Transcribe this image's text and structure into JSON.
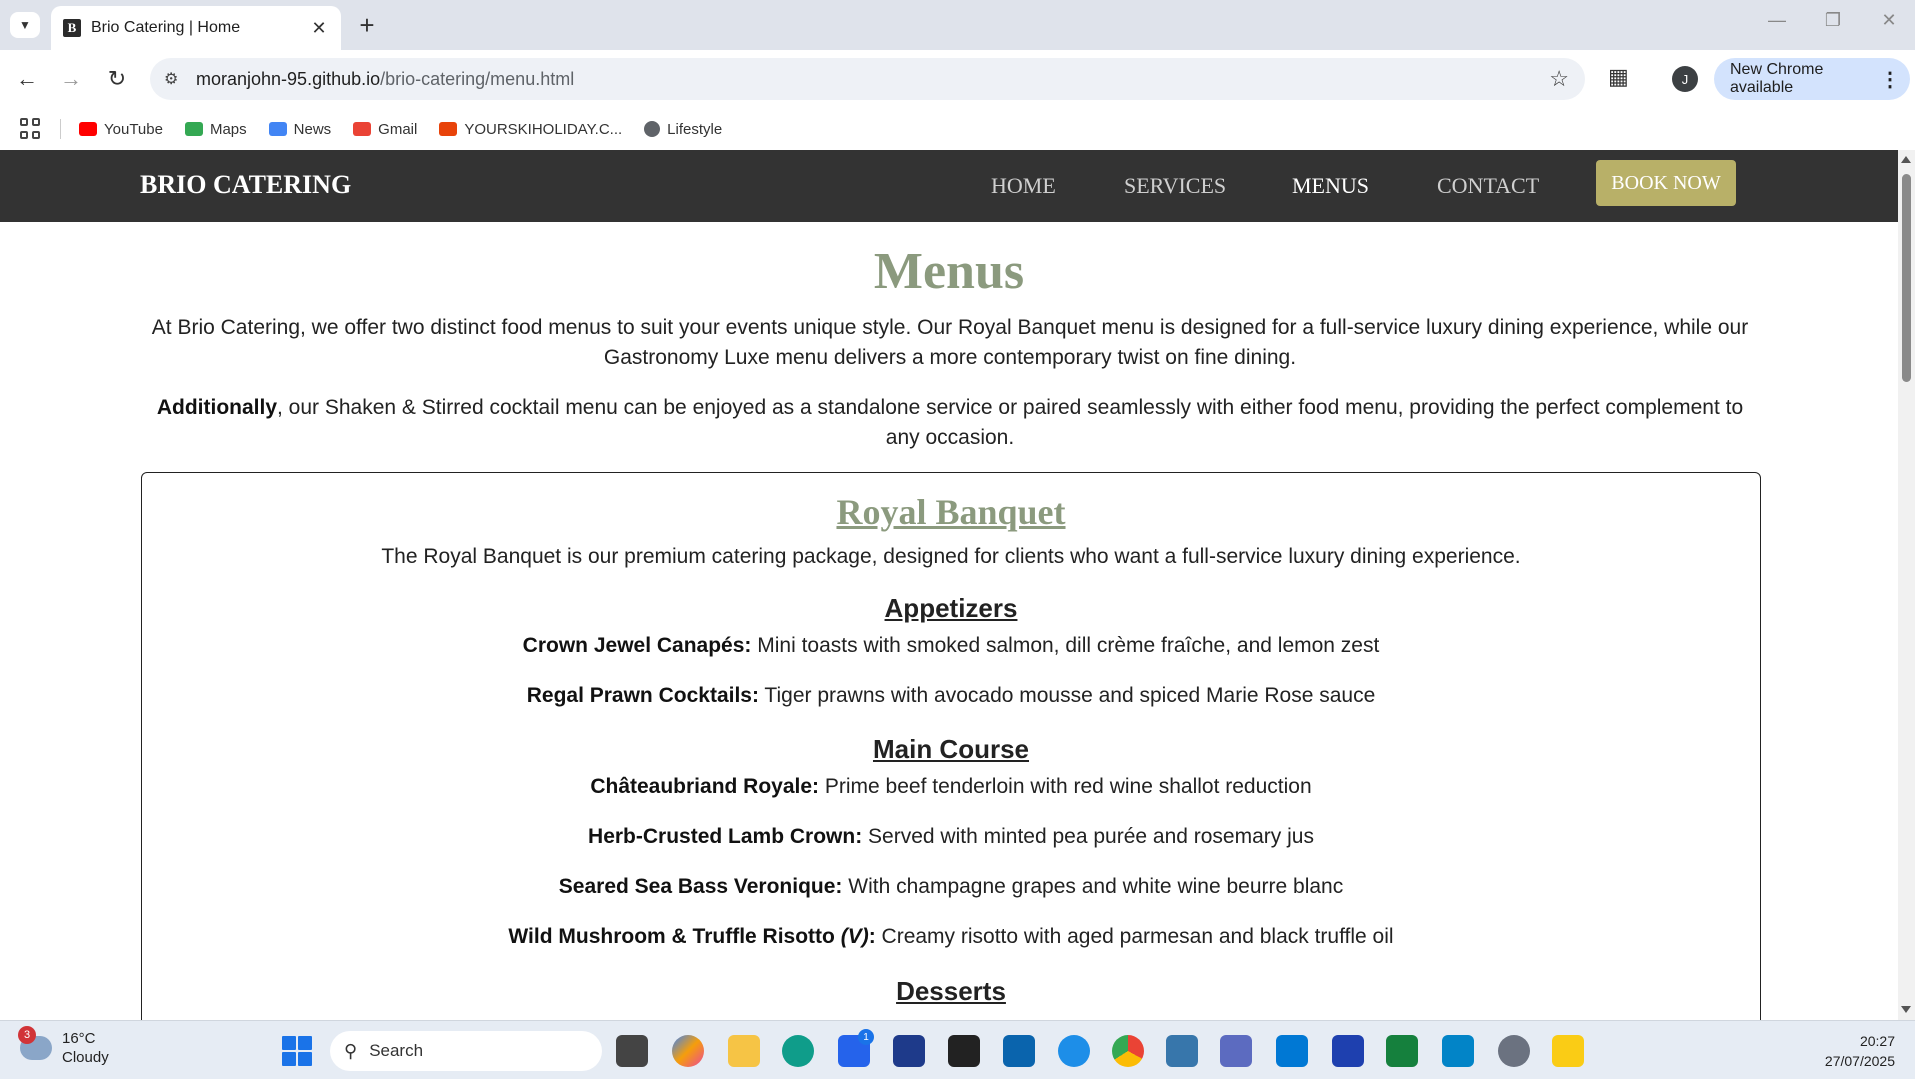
{
  "browser": {
    "tab_title": "Brio Catering | Home",
    "favicon_letter": "B",
    "url_host": "moranjohn-95.github.io",
    "url_path": "/brio-catering/menu.html",
    "update_label": "New Chrome available",
    "profile_initial": "J",
    "bookmarks": [
      {
        "label": "YouTube",
        "color": "#ff0000"
      },
      {
        "label": "Maps",
        "color": "#34a853"
      },
      {
        "label": "News",
        "color": "#4285f4"
      },
      {
        "label": "Gmail",
        "color": "#ea4335"
      },
      {
        "label": "YOURSKIHOLIDAY.C...",
        "color": "#e8430a"
      },
      {
        "label": "Lifestyle",
        "color": "#5f6368"
      }
    ]
  },
  "site": {
    "brand": "BRIO CATERING",
    "nav": [
      "HOME",
      "SERVICES",
      "MENUS",
      "CONTACT"
    ],
    "active_nav": "MENUS",
    "book_label": "BOOK NOW",
    "colors": {
      "nav_bg": "#333333",
      "accent": "#8b9a7e",
      "button": "#b8b068"
    }
  },
  "page": {
    "title": "Menus",
    "intro_1": "At Brio Catering, we offer two distinct food menus to suit your events unique style. Our Royal Banquet menu is designed for a full-service luxury dining experience, while our Gastronomy Luxe menu delivers a more contemporary twist on fine dining.",
    "intro_2_bold": "Additionally",
    "intro_2_rest": ", our Shaken & Stirred cocktail menu can be enjoyed as a standalone service or paired seamlessly with either food menu, providing the perfect complement to any occasion."
  },
  "menu": {
    "title": "Royal Banquet",
    "description": "The Royal Banquet is our premium catering package, designed for clients who want a full-service luxury dining experience.",
    "appetizers_heading": "Appetizers",
    "appetizers": [
      {
        "name": "Crown Jewel Canapés:",
        "desc": " Mini toasts with smoked salmon, dill crème fraîche, and lemon zest"
      },
      {
        "name": "Regal Prawn Cocktails:",
        "desc": " Tiger prawns with avocado mousse and spiced Marie Rose sauce"
      }
    ],
    "main_heading": "Main Course",
    "mains": [
      {
        "name": "Châteaubriand Royale:",
        "desc": " Prime beef tenderloin with red wine shallot reduction"
      },
      {
        "name": "Herb-Crusted Lamb Crown:",
        "desc": " Served with minted pea purée and rosemary jus"
      },
      {
        "name": "Seared Sea Bass Veronique:",
        "desc": " With champagne grapes and white wine beurre blanc"
      },
      {
        "name": "Wild Mushroom & Truffle Risotto ",
        "veg": "(V)",
        "name_end": ":",
        "desc": " Creamy risotto with aged parmesan and black truffle oil"
      }
    ],
    "desserts_heading": "Desserts"
  },
  "taskbar": {
    "weather_temp": "16°C",
    "weather_desc": "Cloudy",
    "weather_badge": "3",
    "search_placeholder": "Search",
    "store_badge": "1",
    "time": "20:27",
    "date": "27/07/2025"
  }
}
